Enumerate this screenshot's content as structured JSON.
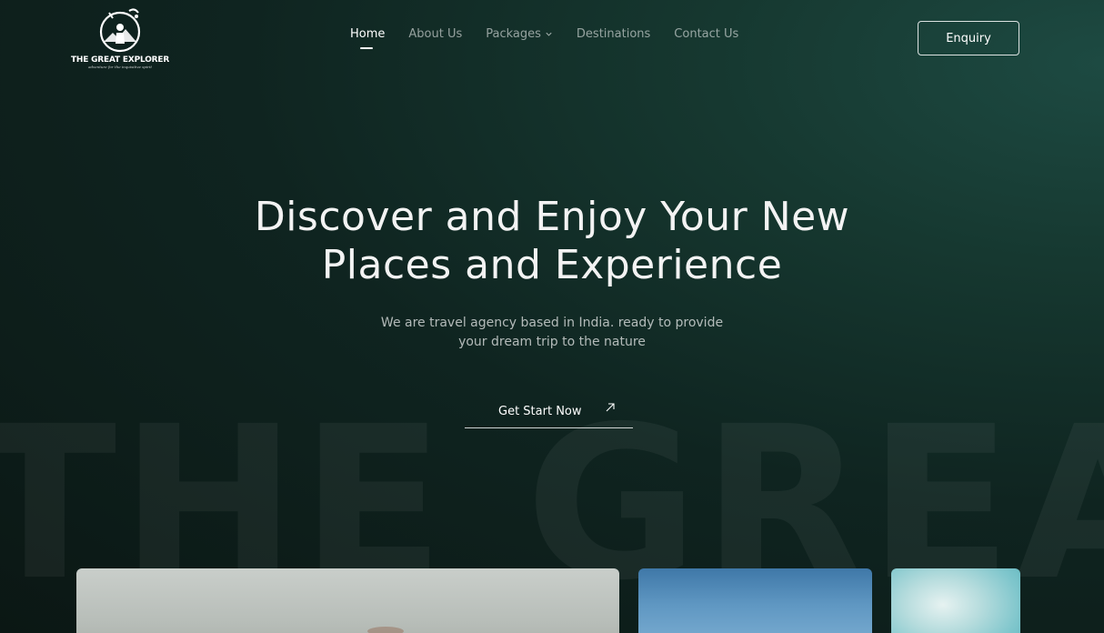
{
  "brand": {
    "name": "THE GREAT EXPLORER",
    "tagline": "adventure for the inquisitive spirit"
  },
  "nav": {
    "items": [
      {
        "label": "Home",
        "active": true
      },
      {
        "label": "About Us",
        "active": false
      },
      {
        "label": "Packages",
        "active": false,
        "has_dropdown": true
      },
      {
        "label": "Destinations",
        "active": false
      },
      {
        "label": "Contact  Us",
        "active": false
      }
    ],
    "enquiry_label": "Enquiry"
  },
  "hero": {
    "title_line1": "Discover and Enjoy Your New",
    "title_line2": "Places and Experience",
    "subtitle_line1": "We are travel agency based in India. ready to provide",
    "subtitle_line2": "your dream trip to the nature",
    "cta_label": "Get Start Now",
    "cta_icon": "arrow-up-right-icon",
    "watermark": "THE GREAT"
  },
  "colors": {
    "background_dark": "#0b1714",
    "background_accent": "#1d4a42",
    "text": "#ffffff"
  }
}
